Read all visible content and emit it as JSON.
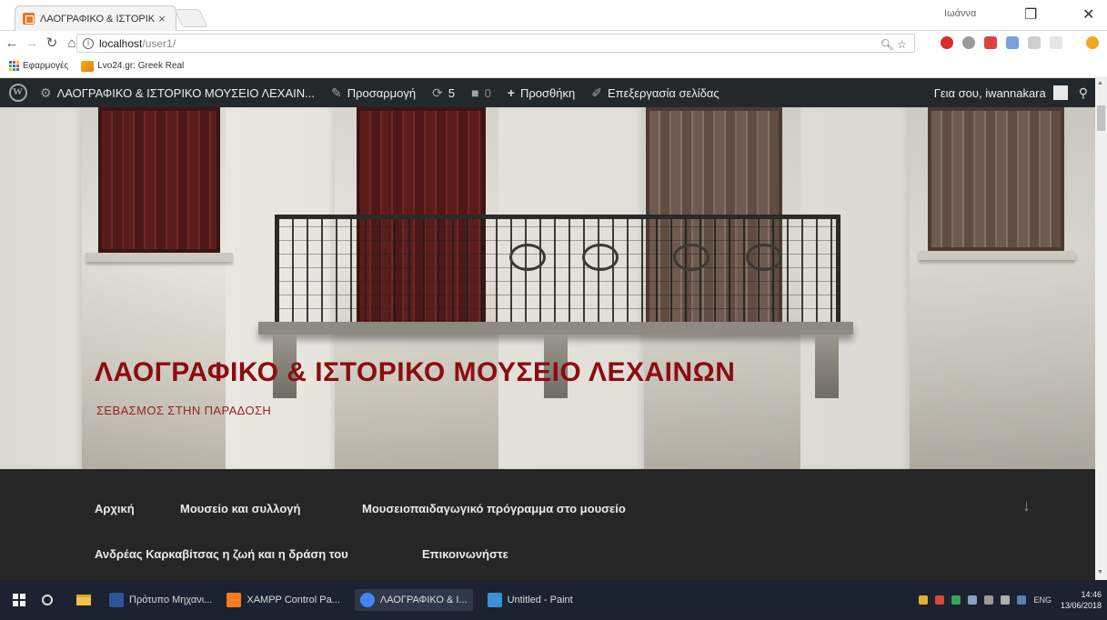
{
  "browser": {
    "tab_title": "ΛΑΟΓΡΑΦΙΚΟ & ΙΣΤΟΡΙΚ",
    "tab_close": "×",
    "profile": "Ιωάννα",
    "url_host": "localhost",
    "url_path": "/user1/",
    "bookmarks": [
      {
        "label": "Εφαρμογές",
        "icon": "apps-grid-icon"
      },
      {
        "label": "Lvo24.gr: Greek Real",
        "icon": "bookmark-site-icon"
      }
    ]
  },
  "adminbar": {
    "site_name": "ΛΑΟΓΡΑΦΙΚΟ & ΙΣΤΟΡΙΚΟ ΜΟΥΣΕΙΟ ΛΕΧΑΙΝ...",
    "customize": "Προσαρμογή",
    "updates_count": "5",
    "comments_count": "0",
    "new": "Προσθήκη",
    "edit_page": "Επεξεργασία σελίδας",
    "greeting": "Γεια σου, iwannakara"
  },
  "hero": {
    "site_title": "ΛΑΟΓΡΑΦΙΚΟ & ΙΣΤΟΡΙΚΟ ΜΟΥΣΕΙΟ ΛΕΧΑΙΝΩΝ",
    "tagline": "ΣΕΒΑΣΜΟΣ ΣΤΗΝ ΠΑΡΑΔΟΣΗ"
  },
  "menu": {
    "items": [
      "Αρχική",
      "Μουσείο και συλλογή",
      "Μουσειοπαιδαγωγικό πρόγραμμα στο μουσείο",
      "Ανδρέας Καρκαβίτσας η ζωή και η δράση του",
      "Επικοινωνήστε"
    ],
    "scroll_down": "↓"
  },
  "taskbar": {
    "apps": [
      {
        "label": "Πρότυπο Μηχανι...",
        "color": "#2b579a"
      },
      {
        "label": "XAMPP Control Pa...",
        "color": "#fb7a24"
      },
      {
        "label": "ΛΑΟΓΡΑΦΙΚΟ & Ι...",
        "color": "#4285f4"
      },
      {
        "label": "Untitled - Paint",
        "color": "#3a8fd6"
      }
    ],
    "lang": "ENG",
    "time": "14:46",
    "date": "13/06/2018"
  },
  "colors": {
    "title_red": "#8b0d10",
    "adminbar_bg": "#23282d",
    "menu_bg": "#262626"
  }
}
